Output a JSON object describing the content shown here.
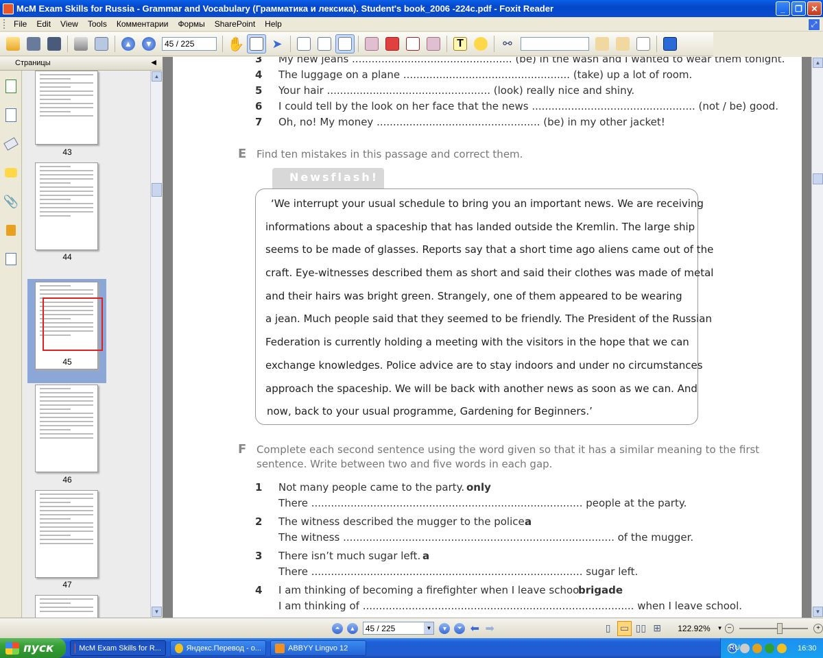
{
  "window": {
    "title": "McM Exam Skills for Russia - Grammar and Vocabulary (Грамматика и лексика). Student's book_2006 -224c.pdf - Foxit Reader"
  },
  "menu": [
    "File",
    "Edit",
    "View",
    "Tools",
    "Комментарии",
    "Формы",
    "SharePoint",
    "Help"
  ],
  "toolbar": {
    "page_value": "45 / 225",
    "search_value": ""
  },
  "sidebar": {
    "header": "Страницы",
    "thumbnails": [
      {
        "label": "43"
      },
      {
        "label": "44"
      },
      {
        "label": "45",
        "selected": true
      },
      {
        "label": "46"
      },
      {
        "label": "47"
      }
    ]
  },
  "document": {
    "top_items": [
      {
        "num": "3",
        "text": "My new jeans .................................................  (be) in the wash and I wanted to wear them tonight."
      },
      {
        "num": "4",
        "text": "The luggage on a plane ...................................................  (take) up a lot of room."
      },
      {
        "num": "5",
        "text": "Your hair ..................................................  (look) really nice and shiny."
      },
      {
        "num": "6",
        "text": "I could tell by the look on her face that the news ..................................................  (not / be) good."
      },
      {
        "num": "7",
        "text": "Oh, no! My money ..................................................  (be) in my other jacket!"
      }
    ],
    "section_e": {
      "letter": "E",
      "heading": "Find ten mistakes in this passage and correct them.",
      "tab_label": "Newsflash!",
      "passage_lines": [
        "‘We interrupt your usual schedule to bring you an important news. We are receiving",
        "informations about a spaceship that has landed outside the Kremlin. The large ship",
        "seems to be made of glasses. Reports say that a short time ago aliens came out of the",
        "craft. Eye-witnesses described them as short and said their clothes was made of metal",
        "and their hairs was bright green. Strangely, one of them appeared to be wearing",
        "a jean. Much people said that they seemed to be friendly. The President of the Russian",
        "Federation is currently holding a meeting with the visitors in the hope that we can",
        "exchange knowledges. Police advice are to stay indoors and under no circumstances",
        "approach the spaceship. We will be back with another news as soon as we can. And",
        "now, back to your usual programme, Gardening for Beginners.’"
      ]
    },
    "section_f": {
      "letter": "F",
      "heading_line1": "Complete each second sentence using the word given so that it has a similar meaning to the first",
      "heading_line2": "sentence. Write between two and five words in each gap.",
      "items": [
        {
          "num": "1",
          "sentence": "Not many people came to the party.",
          "keyword": "only",
          "line2": "There ...................................................................................  people at the party."
        },
        {
          "num": "2",
          "sentence": "The witness described the mugger to the police.",
          "keyword": "a",
          "line2": "The witness ...................................................................................  of the mugger."
        },
        {
          "num": "3",
          "sentence": "There isn’t much sugar left.",
          "keyword": "a",
          "line2": "There ...................................................................................  sugar left."
        },
        {
          "num": "4",
          "sentence": "I am thinking of becoming a firefighter when I leave school.",
          "keyword": "brigade",
          "line2": "I am thinking of ...................................................................................  when I leave school."
        }
      ]
    }
  },
  "statusbar": {
    "page_value": "45 / 225",
    "zoom": "122.92%"
  },
  "taskbar": {
    "start_label": "пуск",
    "tasks": [
      {
        "label": "McM Exam Skills for R...",
        "icon_color": "#e8562a",
        "active": true
      },
      {
        "label": "Яндекс.Перевод - о...",
        "icon_color": "#f0c020",
        "active": false
      },
      {
        "label": "ABBYY Lingvo 12",
        "icon_color": "#f09020",
        "active": false
      }
    ],
    "lang": "RU",
    "clock": "16:30"
  }
}
